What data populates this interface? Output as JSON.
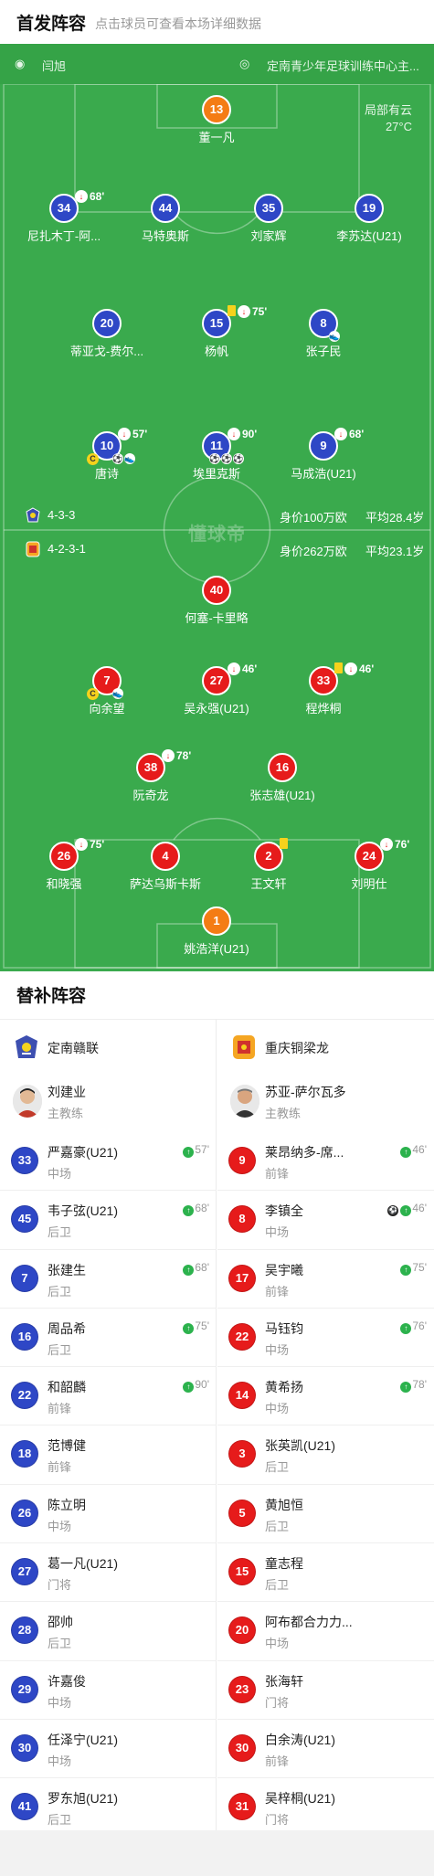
{
  "header": {
    "title": "首发阵容",
    "subtitle": "点击球员可查看本场详细数据"
  },
  "field": {
    "referee": "闫旭",
    "venue": "定南青少年足球训练中心主...",
    "weather": "局部有云",
    "temperature": "27°C",
    "watermark": "懂球帝",
    "home_team": {
      "formation": "4-3-3",
      "value": "身价100万欧",
      "avg_age": "平均28.4岁"
    },
    "away_team": {
      "formation": "4-2-3-1",
      "value": "身价262万欧",
      "avg_age": "平均23.1岁"
    }
  },
  "home_players": [
    {
      "num": "13",
      "name": "董一凡",
      "sub_min": ""
    },
    {
      "num": "34",
      "name": "尼扎木丁-阿...",
      "sub_min": "68'"
    },
    {
      "num": "44",
      "name": "马特奥斯",
      "sub_min": ""
    },
    {
      "num": "35",
      "name": "刘家辉",
      "sub_min": ""
    },
    {
      "num": "19",
      "name": "李苏达(U21)",
      "sub_min": ""
    },
    {
      "num": "20",
      "name": "蒂亚戈-费尔...",
      "sub_min": ""
    },
    {
      "num": "15",
      "name": "杨帆",
      "sub_min": "75'"
    },
    {
      "num": "8",
      "name": "张子民",
      "sub_min": ""
    },
    {
      "num": "10",
      "name": "唐诗",
      "sub_min": "57'"
    },
    {
      "num": "11",
      "name": "埃里克斯",
      "sub_min": "90'"
    },
    {
      "num": "9",
      "name": "马成浩(U21)",
      "sub_min": "68'"
    }
  ],
  "away_players": [
    {
      "num": "40",
      "name": "何塞-卡里略",
      "sub_min": ""
    },
    {
      "num": "7",
      "name": "向余望",
      "sub_min": ""
    },
    {
      "num": "27",
      "name": "吴永强(U21)",
      "sub_min": "46'"
    },
    {
      "num": "33",
      "name": "程烨桐",
      "sub_min": "46'"
    },
    {
      "num": "38",
      "name": "阮奇龙",
      "sub_min": "78'"
    },
    {
      "num": "16",
      "name": "张志雄(U21)",
      "sub_min": ""
    },
    {
      "num": "26",
      "name": "和晓强",
      "sub_min": "75'"
    },
    {
      "num": "4",
      "name": "萨达乌斯卡斯",
      "sub_min": ""
    },
    {
      "num": "2",
      "name": "王文轩",
      "sub_min": ""
    },
    {
      "num": "24",
      "name": "刘明仕",
      "sub_min": "76'"
    },
    {
      "num": "1",
      "name": "姚浩洋(U21)",
      "sub_min": ""
    }
  ],
  "icons": {
    "captain": "C",
    "goal": "⚽",
    "sub_out": "↓",
    "sub_in": "↑"
  },
  "subs": {
    "title": "替补阵容",
    "home": {
      "team": "定南赣联",
      "coach": {
        "name": "刘建业",
        "role": "主教练"
      },
      "players": [
        {
          "num": "33",
          "name": "严嘉豪(U21)",
          "pos": "中场",
          "min": "57'"
        },
        {
          "num": "45",
          "name": "韦子弦(U21)",
          "pos": "后卫",
          "min": "68'"
        },
        {
          "num": "7",
          "name": "张建生",
          "pos": "后卫",
          "min": "68'"
        },
        {
          "num": "16",
          "name": "周品希",
          "pos": "后卫",
          "min": "75'"
        },
        {
          "num": "22",
          "name": "和韶麟",
          "pos": "前锋",
          "min": "90'"
        },
        {
          "num": "18",
          "name": "范博健",
          "pos": "前锋",
          "min": ""
        },
        {
          "num": "26",
          "name": "陈立明",
          "pos": "中场",
          "min": ""
        },
        {
          "num": "27",
          "name": "葛一凡(U21)",
          "pos": "门将",
          "min": ""
        },
        {
          "num": "28",
          "name": "邵帅",
          "pos": "后卫",
          "min": ""
        },
        {
          "num": "29",
          "name": "许嘉俊",
          "pos": "中场",
          "min": ""
        },
        {
          "num": "30",
          "name": "任泽宁(U21)",
          "pos": "中场",
          "min": ""
        },
        {
          "num": "41",
          "name": "罗东旭(U21)",
          "pos": "后卫",
          "min": ""
        }
      ]
    },
    "away": {
      "team": "重庆铜梁龙",
      "coach": {
        "name": "苏亚-萨尔瓦多",
        "role": "主教练"
      },
      "players": [
        {
          "num": "9",
          "name": "莱昂纳多-席...",
          "pos": "前锋",
          "min": "46'"
        },
        {
          "num": "8",
          "name": "李镇全",
          "pos": "中场",
          "min": "46'"
        },
        {
          "num": "17",
          "name": "吴宇曦",
          "pos": "前锋",
          "min": "75'"
        },
        {
          "num": "22",
          "name": "马钰钧",
          "pos": "中场",
          "min": "76'"
        },
        {
          "num": "14",
          "name": "黄希扬",
          "pos": "中场",
          "min": "78'"
        },
        {
          "num": "3",
          "name": "张英凯(U21)",
          "pos": "后卫",
          "min": ""
        },
        {
          "num": "5",
          "name": "黄旭恒",
          "pos": "后卫",
          "min": ""
        },
        {
          "num": "15",
          "name": "童志程",
          "pos": "后卫",
          "min": ""
        },
        {
          "num": "20",
          "name": "阿布都合力力...",
          "pos": "中场",
          "min": ""
        },
        {
          "num": "23",
          "name": "张海轩",
          "pos": "门将",
          "min": ""
        },
        {
          "num": "30",
          "name": "白余涛(U21)",
          "pos": "前锋",
          "min": ""
        },
        {
          "num": "31",
          "name": "吴梓桐(U21)",
          "pos": "门将",
          "min": ""
        }
      ]
    }
  },
  "colors": {
    "home": "#2e47c6",
    "away": "#e61b1b",
    "goalkeeper_home": "#f47c14",
    "pitch": "#3aaa4d"
  }
}
